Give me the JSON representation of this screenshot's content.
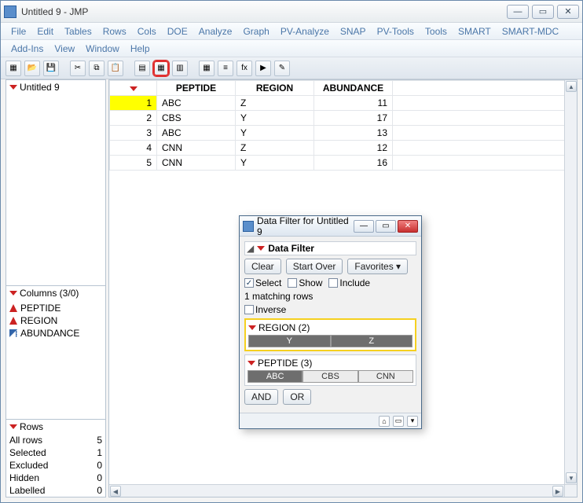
{
  "window": {
    "title": "Untitled 9 - JMP"
  },
  "menus": [
    "File",
    "Edit",
    "Tables",
    "Rows",
    "Cols",
    "DOE",
    "Analyze",
    "Graph",
    "PV-Analyze",
    "SNAP",
    "PV-Tools",
    "Tools",
    "SMART",
    "SMART-MDC"
  ],
  "menus2": [
    "Add-Ins",
    "View",
    "Window",
    "Help"
  ],
  "left": {
    "tab": "Untitled 9",
    "columns_hdr": "Columns (3/0)",
    "columns": [
      "PEPTIDE",
      "REGION",
      "ABUNDANCE"
    ],
    "rows_hdr": "Rows",
    "rowstats": [
      {
        "label": "All rows",
        "val": "5"
      },
      {
        "label": "Selected",
        "val": "1"
      },
      {
        "label": "Excluded",
        "val": "0"
      },
      {
        "label": "Hidden",
        "val": "0"
      },
      {
        "label": "Labelled",
        "val": "0"
      }
    ]
  },
  "grid": {
    "headers": [
      "PEPTIDE",
      "REGION",
      "ABUNDANCE"
    ],
    "rows": [
      {
        "n": "1",
        "sel": true,
        "c": [
          "ABC",
          "Z",
          "11"
        ]
      },
      {
        "n": "2",
        "sel": false,
        "c": [
          "CBS",
          "Y",
          "17"
        ]
      },
      {
        "n": "3",
        "sel": false,
        "c": [
          "ABC",
          "Y",
          "13"
        ]
      },
      {
        "n": "4",
        "sel": false,
        "c": [
          "CNN",
          "Z",
          "12"
        ]
      },
      {
        "n": "5",
        "sel": false,
        "c": [
          "CNN",
          "Y",
          "16"
        ]
      }
    ]
  },
  "dialog": {
    "title": "Data Filter for Untitled 9",
    "heading": "Data Filter",
    "clear": "Clear",
    "start_over": "Start Over",
    "favorites": "Favorites ▾",
    "select": "Select",
    "show": "Show",
    "include": "Include",
    "matching": "1 matching rows",
    "inverse": "Inverse",
    "region_hdr": "REGION (2)",
    "region_opts": [
      "Y",
      "Z"
    ],
    "peptide_hdr": "PEPTIDE (3)",
    "peptide_opts": [
      "ABC",
      "CBS",
      "CNN"
    ],
    "and": "AND",
    "or": "OR"
  }
}
